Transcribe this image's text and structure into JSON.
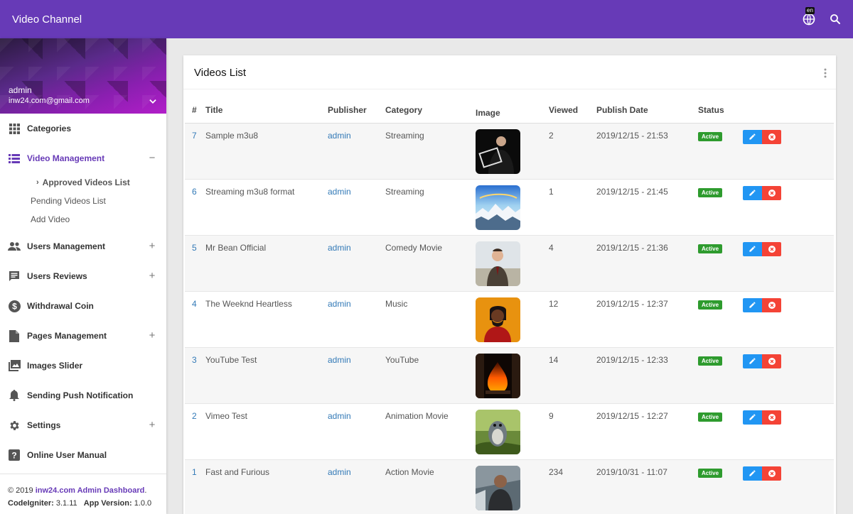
{
  "app": {
    "title": "Video Channel",
    "lang_badge": "en",
    "icons": {
      "language": "globe-icon",
      "search": "search-icon"
    },
    "accent_color": "#673ab7"
  },
  "sidebar": {
    "user_name": "admin",
    "user_email": "inw24.com@gmail.com",
    "items": [
      {
        "label": "Categories",
        "icon": "grid-icon",
        "toggle": ""
      },
      {
        "label": "Video Management",
        "icon": "list-icon",
        "toggle": "−",
        "active": true,
        "sub": [
          {
            "label": "Approved Videos List",
            "active": true
          },
          {
            "label": "Pending Videos List"
          },
          {
            "label": "Add Video"
          }
        ]
      },
      {
        "label": "Users Management",
        "icon": "users-icon",
        "toggle": "+"
      },
      {
        "label": "Users Reviews",
        "icon": "comment-icon",
        "toggle": "+"
      },
      {
        "label": "Withdrawal Coin",
        "icon": "dollar-icon",
        "toggle": ""
      },
      {
        "label": "Pages Management",
        "icon": "page-icon",
        "toggle": "+"
      },
      {
        "label": "Images Slider",
        "icon": "image-icon",
        "toggle": ""
      },
      {
        "label": "Sending Push Notification",
        "icon": "bell-icon",
        "toggle": ""
      },
      {
        "label": "Settings",
        "icon": "gear-icon",
        "toggle": "+"
      },
      {
        "label": "Online User Manual",
        "icon": "help-icon",
        "toggle": ""
      }
    ],
    "footer": {
      "copyright": "© 2019",
      "link": "inw24.com Admin Dashboard",
      "dot": ".",
      "ci_label": "CodeIgniter:",
      "ci_version": "3.1.11",
      "app_label": "App Version:",
      "app_version": "1.0.0"
    }
  },
  "card": {
    "title": "Videos List",
    "columns": [
      "#",
      "Title",
      "Publisher",
      "Category",
      "Image",
      "Viewed",
      "Publish Date",
      "Status",
      ""
    ],
    "rows": [
      {
        "id": "7",
        "title": "Sample m3u8",
        "publisher": "admin",
        "category": "Streaming",
        "viewed": "2",
        "date": "2019/12/15 - 21:53",
        "status": "Active",
        "image": "tablet-presenter-thumbnail"
      },
      {
        "id": "6",
        "title": "Streaming m3u8 format",
        "publisher": "admin",
        "category": "Streaming",
        "viewed": "1",
        "date": "2019/12/15 - 21:45",
        "status": "Active",
        "image": "snowy-mountains-thumbnail"
      },
      {
        "id": "5",
        "title": "Mr Bean Official",
        "publisher": "admin",
        "category": "Comedy Movie",
        "viewed": "4",
        "date": "2019/12/15 - 21:36",
        "status": "Active",
        "image": "mr-bean-thumbnail"
      },
      {
        "id": "4",
        "title": "The Weeknd Heartless",
        "publisher": "admin",
        "category": "Music",
        "viewed": "12",
        "date": "2019/12/15 - 12:37",
        "status": "Active",
        "image": "singer-thumbnail"
      },
      {
        "id": "3",
        "title": "YouTube Test",
        "publisher": "admin",
        "category": "YouTube",
        "viewed": "14",
        "date": "2019/12/15 - 12:33",
        "status": "Active",
        "image": "fireplace-thumbnail"
      },
      {
        "id": "2",
        "title": "Vimeo Test",
        "publisher": "admin",
        "category": "Animation Movie",
        "viewed": "9",
        "date": "2019/12/15 - 12:27",
        "status": "Active",
        "image": "animated-character-thumbnail"
      },
      {
        "id": "1",
        "title": "Fast and Furious",
        "publisher": "admin",
        "category": "Action Movie",
        "viewed": "234",
        "date": "2019/10/31 - 11:07",
        "status": "Active",
        "image": "action-hero-thumbnail"
      }
    ],
    "row_actions": {
      "edit_icon": "pencil-icon",
      "delete_icon": "close-circle-icon"
    }
  }
}
